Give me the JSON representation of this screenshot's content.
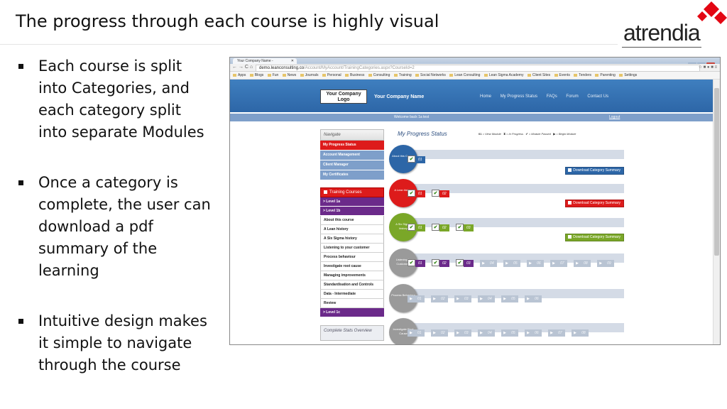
{
  "slide": {
    "title": "The progress through each course is highly visual",
    "logo_text": "atrendia",
    "bullets": [
      "Each course is split into Categories, and each category split into separate Modules",
      "Once a category is complete, the user can download a pdf summary of the learning",
      "Intuitive design makes it simple to navigate through the course"
    ]
  },
  "browser": {
    "tab_title": "Your Company Name - ",
    "url_host": "demo.leanconsulting.co",
    "url_path": "/Account/MyAccount/TrainingCategories.aspx?CourseId=2",
    "nav_arrows": "← → C ⌂",
    "ext_icons": "☆ ■ ● ■ ≡",
    "bookmarks": [
      "Apps",
      "Blogs",
      "Fun",
      "News",
      "Journals",
      "Personal",
      "Business",
      "Consulting",
      "Training",
      "Social Networks",
      "Lean Consulting",
      "Lean Sigma Academy",
      "Client Sites",
      "Events",
      "Tenders",
      "Parenting",
      "Settings"
    ]
  },
  "site": {
    "logo_line1": "Your Company",
    "logo_line2": "Logo",
    "name": "Your Company Name",
    "nav": [
      "Home",
      "My Progress Status",
      "FAQs",
      "Forum",
      "Contact Us"
    ],
    "welcome": "Welcome back 1a test",
    "logout": "Logout"
  },
  "sidebar": {
    "navigate": "Navigate",
    "items": [
      "My Progress Status",
      "Account Management",
      "Client Manager",
      "My Certificates"
    ],
    "training_courses": "Training Courses",
    "level_1a": "> Level 1a",
    "level_1b": "> Level 1b",
    "subitems": [
      "About this course",
      "A Lean history",
      "A Six Sigma history",
      "Listening to your customer",
      "Process behaviour",
      "Investigate root cause",
      "Managing improvements",
      "Standardisation and Controls",
      "Data - Intermediate",
      "Review"
    ],
    "level_1c": "> Level 1c",
    "stats": "Complete Stats Overview"
  },
  "main": {
    "title": "My Progress Status",
    "legend": {
      "view_num": "01",
      "view": " = View Module",
      "inprog_icon": "⧗",
      "inprog": " = In Progress",
      "passed_icon": "✔",
      "passed": " = Module Passed",
      "begin_icon": "▶",
      "begin": " = Begin Module"
    },
    "download_label": "Download Category Summary",
    "categories": [
      {
        "name": "About this Course",
        "color": "#2d66a7"
      },
      {
        "name": "A Lean history",
        "color": "#dd1b1b"
      },
      {
        "name": "A Six Sigma history",
        "color": "#7aa728"
      },
      {
        "name": "Listening to Customers",
        "color": "#9a9a9a"
      },
      {
        "name": "Process Behaviour",
        "color": "#9a9a9a"
      },
      {
        "name": "Investigate Root Cause",
        "color": "#9a9a9a"
      }
    ],
    "modules": {
      "m01": "01",
      "m02": "02",
      "m03": "03",
      "m04": "04",
      "m05": "05",
      "m06": "06",
      "m07": "07",
      "m08": "08",
      "m09": "09"
    },
    "check": "✔",
    "play": "▶"
  }
}
